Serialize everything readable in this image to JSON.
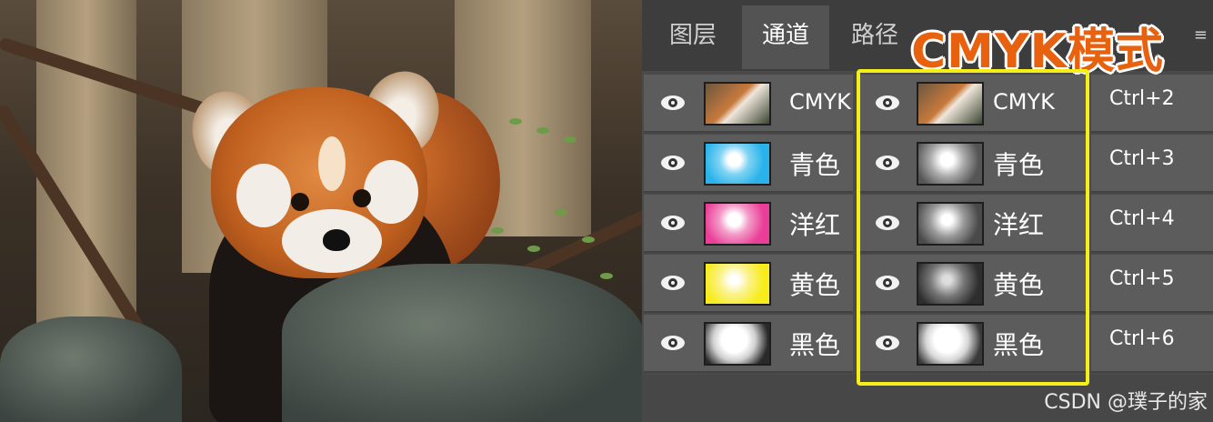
{
  "tabs": [
    {
      "label": "图层",
      "active": false
    },
    {
      "label": "通道",
      "active": true
    },
    {
      "label": "路径",
      "active": false
    }
  ],
  "title": "CMYK模式",
  "panel_menu_icon": "hamburger-menu-icon",
  "channels_left": [
    {
      "label": "CMYK"
    },
    {
      "label": "青色"
    },
    {
      "label": "洋红"
    },
    {
      "label": "黄色"
    },
    {
      "label": "黑色"
    }
  ],
  "channels_right": [
    {
      "label": "CMYK"
    },
    {
      "label": "青色"
    },
    {
      "label": "洋红"
    },
    {
      "label": "黄色"
    },
    {
      "label": "黑色"
    }
  ],
  "shortcuts": [
    "Ctrl+2",
    "Ctrl+3",
    "Ctrl+4",
    "Ctrl+5",
    "Ctrl+6"
  ],
  "watermark": "CSDN @璞子的家",
  "colors": {
    "title": "#e8610f",
    "highlight": "#f6ee17",
    "cyan": "#29b3ea",
    "magenta": "#ea3f98",
    "yellow": "#f8ec1c"
  }
}
